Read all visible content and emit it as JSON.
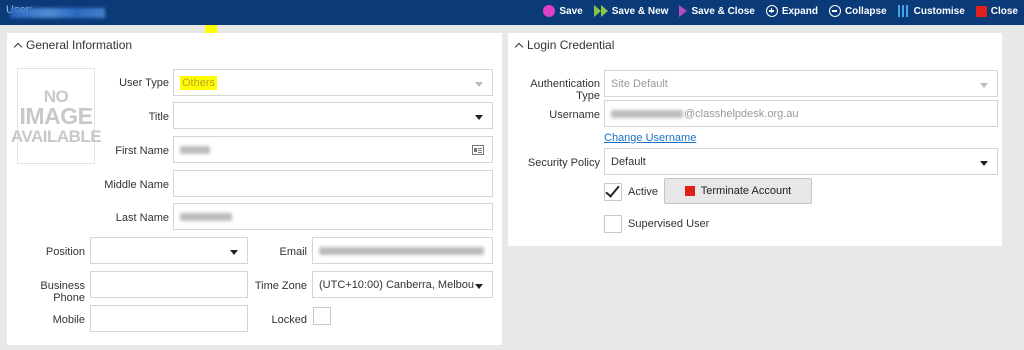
{
  "header": {
    "title_label": "User:",
    "toolbar": [
      {
        "label": "Save",
        "icon": "save-icon"
      },
      {
        "label": "Save & New",
        "icon": "save-new-icon"
      },
      {
        "label": "Save & Close",
        "icon": "save-close-icon"
      },
      {
        "label": "Expand",
        "icon": "expand-icon"
      },
      {
        "label": "Collapse",
        "icon": "collapse-icon"
      },
      {
        "label": "Customise",
        "icon": "customise-icon"
      },
      {
        "label": "Close",
        "icon": "close-icon"
      }
    ]
  },
  "general": {
    "heading": "General Information",
    "no_image": [
      "NO",
      "IMAGE",
      "AVAILABLE"
    ],
    "labels": {
      "user_type": "User Type",
      "title": "Title",
      "first_name": "First Name",
      "middle_name": "Middle Name",
      "last_name": "Last Name",
      "position": "Position",
      "email": "Email",
      "business_phone": "Business Phone",
      "time_zone": "Time Zone",
      "mobile": "Mobile",
      "locked": "Locked"
    },
    "values": {
      "user_type": "Others",
      "title": "",
      "middle_name": "",
      "position": "",
      "business_phone": "",
      "time_zone": "(UTC+10:00) Canberra, Melbou",
      "mobile": ""
    }
  },
  "login": {
    "heading": "Login Credential",
    "labels": {
      "authentication_type": "Authentication Type",
      "username": "Username",
      "security_policy": "Security Policy",
      "active": "Active",
      "supervised_user": "Supervised User"
    },
    "values": {
      "authentication_type": "Site Default",
      "username_domain": "@classhelpdesk.org.au",
      "security_policy": "Default"
    },
    "change_username_link": "Change Username",
    "terminate_button": "Terminate Account",
    "active_checked": true,
    "supervised_checked": false
  },
  "colors": {
    "header_bg": "#0b3a78",
    "highlight": "#ffff00",
    "link": "#1a6fc7",
    "danger": "#e0201a"
  }
}
